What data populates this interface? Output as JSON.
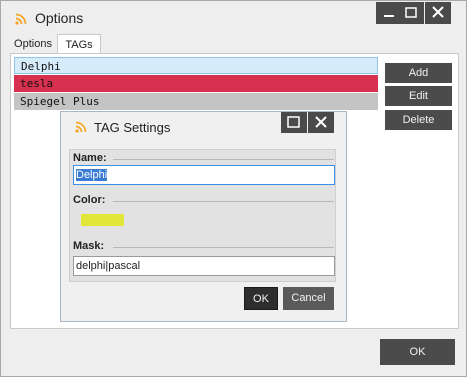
{
  "window": {
    "title": "Options",
    "icon": "rss-icon",
    "controls": [
      "minimize-icon",
      "maximize-icon",
      "close-icon"
    ],
    "tabs": [
      {
        "label": "Options",
        "active": false
      },
      {
        "label": "TAGs",
        "active": true
      }
    ],
    "ok_label": "OK"
  },
  "tag_list": {
    "items": [
      {
        "label": "Delphi",
        "state": "selected",
        "color": "#d7ecfb"
      },
      {
        "label": "tesla",
        "color": "#d8304f"
      },
      {
        "label": "Spiegel Plus",
        "color": "#c4c4c4"
      }
    ]
  },
  "side_buttons": {
    "add_label": "Add",
    "edit_label": "Edit",
    "delete_label": "Delete"
  },
  "dialog": {
    "title": "TAG Settings",
    "icon": "rss-icon",
    "controls": [
      "maximize-icon",
      "close-icon"
    ],
    "name_label": "Name:",
    "name_value": "Delphi",
    "color_label": "Color:",
    "color_value": "#e2e63a",
    "mask_label": "Mask:",
    "mask_value": "delphi|pascal",
    "ok_label": "OK",
    "cancel_label": "Cancel"
  },
  "colors": {
    "accent": "#f5a623",
    "dark_button": "#4b4b4b",
    "selection": "#3a7bd5"
  }
}
